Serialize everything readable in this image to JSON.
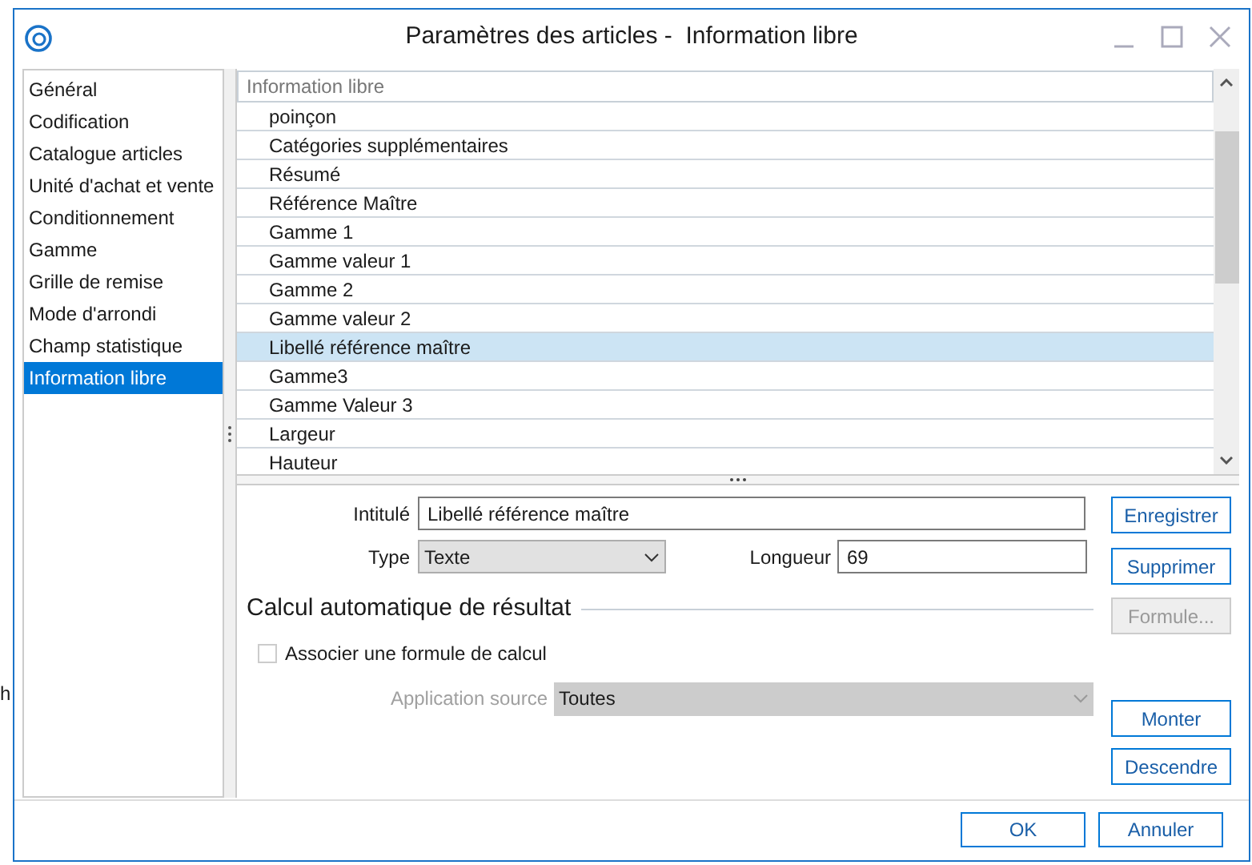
{
  "background": {
    "fragment": "h"
  },
  "window": {
    "title": "Paramètres des articles -  Information libre"
  },
  "nav": [
    {
      "label": "Général",
      "selected": false
    },
    {
      "label": "Codification",
      "selected": false
    },
    {
      "label": "Catalogue articles",
      "selected": false
    },
    {
      "label": "Unité d'achat et vente",
      "selected": false
    },
    {
      "label": "Conditionnement",
      "selected": false
    },
    {
      "label": "Gamme",
      "selected": false
    },
    {
      "label": "Grille de remise",
      "selected": false
    },
    {
      "label": "Mode d'arrondi",
      "selected": false
    },
    {
      "label": "Champ statistique",
      "selected": false
    },
    {
      "label": "Information libre",
      "selected": true
    }
  ],
  "grid": {
    "header": "Information libre",
    "rows": [
      {
        "label": "poinçon",
        "selected": false
      },
      {
        "label": "Catégories supplémentaires",
        "selected": false
      },
      {
        "label": "Résumé",
        "selected": false
      },
      {
        "label": "Référence Maître",
        "selected": false
      },
      {
        "label": "Gamme 1",
        "selected": false
      },
      {
        "label": "Gamme valeur 1",
        "selected": false
      },
      {
        "label": "Gamme 2",
        "selected": false
      },
      {
        "label": "Gamme valeur 2",
        "selected": false
      },
      {
        "label": "Libellé référence maître",
        "selected": true
      },
      {
        "label": "Gamme3",
        "selected": false
      },
      {
        "label": "Gamme Valeur 3",
        "selected": false
      },
      {
        "label": "Largeur",
        "selected": false
      },
      {
        "label": "Hauteur",
        "selected": false
      }
    ]
  },
  "form": {
    "intitule": {
      "label": "Intitulé",
      "value": "Libellé référence maître"
    },
    "type": {
      "label": "Type",
      "value": "Texte"
    },
    "longueur": {
      "label": "Longueur",
      "value": "69"
    },
    "section": "Calcul automatique de résultat",
    "formula_checkbox": {
      "label": "Associer une formule de calcul",
      "checked": false
    },
    "source": {
      "label": "Application source",
      "value": "Toutes",
      "disabled": true
    }
  },
  "side_buttons": [
    {
      "label": "Enregistrer",
      "disabled": false
    },
    {
      "label": "Supprimer",
      "disabled": false
    },
    {
      "label": "Formule...",
      "disabled": true
    },
    {
      "label": "Monter",
      "disabled": false
    },
    {
      "label": "Descendre",
      "disabled": false
    }
  ],
  "footer_buttons": [
    "OK",
    "Annuler"
  ]
}
